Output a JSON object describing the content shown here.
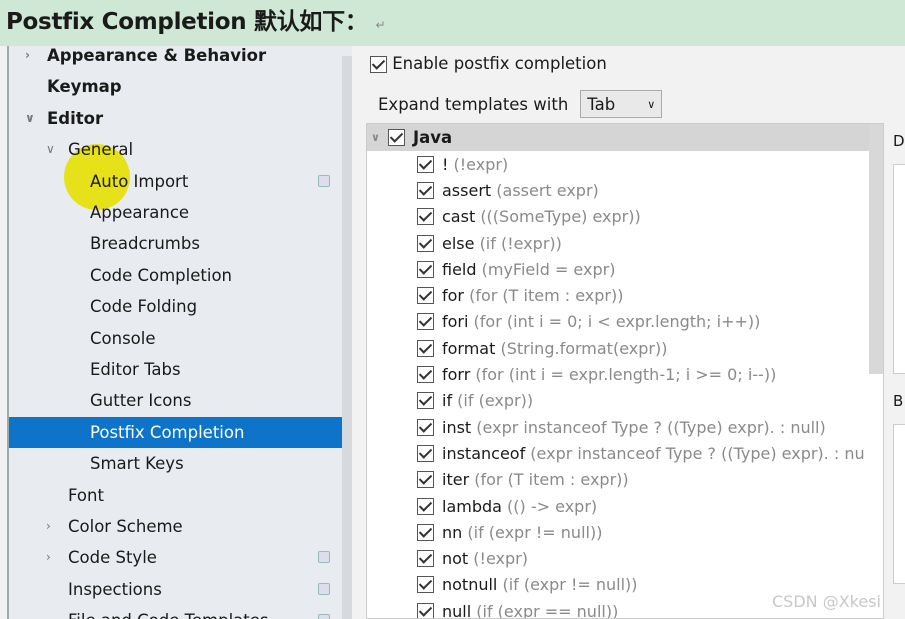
{
  "header": {
    "title": "Postfix Completion 默认如下：",
    "return_mark": "↵"
  },
  "sidebar": {
    "items": [
      {
        "label": "Appearance & Behavior",
        "bold": true,
        "level": 0,
        "arrow": "right"
      },
      {
        "label": "Keymap",
        "bold": true,
        "level": 0
      },
      {
        "label": "Editor",
        "bold": true,
        "level": 0,
        "arrow": "down"
      },
      {
        "label": "General",
        "level": 1,
        "arrow": "down"
      },
      {
        "label": "Auto Import",
        "level": 2,
        "copy": true
      },
      {
        "label": "Appearance",
        "level": 2
      },
      {
        "label": "Breadcrumbs",
        "level": 2
      },
      {
        "label": "Code Completion",
        "level": 2
      },
      {
        "label": "Code Folding",
        "level": 2
      },
      {
        "label": "Console",
        "level": 2
      },
      {
        "label": "Editor Tabs",
        "level": 2
      },
      {
        "label": "Gutter Icons",
        "level": 2
      },
      {
        "label": "Postfix Completion",
        "level": 2,
        "selected": true
      },
      {
        "label": "Smart Keys",
        "level": 2
      },
      {
        "label": "Font",
        "level": 1
      },
      {
        "label": "Color Scheme",
        "level": 1,
        "arrow": "right"
      },
      {
        "label": "Code Style",
        "level": 1,
        "arrow": "right",
        "copy": true
      },
      {
        "label": "Inspections",
        "level": 1,
        "copy": true
      },
      {
        "label": "File and Code Templates",
        "level": 1,
        "copy": true
      }
    ]
  },
  "main": {
    "enable_label": "Enable postfix completion",
    "enable_checked": true,
    "expand_label": "Expand templates with",
    "expand_value": "Tab",
    "group": {
      "label": "Java",
      "checked": true
    },
    "templates": [
      {
        "key": "!",
        "desc": "(!expr)"
      },
      {
        "key": "assert",
        "desc": "(assert expr)"
      },
      {
        "key": "cast",
        "desc": "(((SomeType) expr))"
      },
      {
        "key": "else",
        "desc": "(if (!expr))"
      },
      {
        "key": "field",
        "desc": "(myField = expr)"
      },
      {
        "key": "for",
        "desc": "(for (T item : expr))"
      },
      {
        "key": "fori",
        "desc": "(for (int i = 0; i < expr.length; i++))"
      },
      {
        "key": "format",
        "desc": "(String.format(expr))"
      },
      {
        "key": "forr",
        "desc": "(for (int i = expr.length-1; i >= 0; i--))"
      },
      {
        "key": "if",
        "desc": "(if (expr))"
      },
      {
        "key": "inst",
        "desc": "(expr instanceof Type ? ((Type) expr). : null)"
      },
      {
        "key": "instanceof",
        "desc": "(expr instanceof Type ? ((Type) expr). : nu"
      },
      {
        "key": "iter",
        "desc": "(for (T item : expr))"
      },
      {
        "key": "lambda",
        "desc": "(() -> expr)"
      },
      {
        "key": "nn",
        "desc": "(if (expr != null))"
      },
      {
        "key": "not",
        "desc": "(!expr)"
      },
      {
        "key": "notnull",
        "desc": "(if (expr != null))"
      },
      {
        "key": "null",
        "desc": "(if (expr == null))"
      }
    ],
    "desc_label": "D",
    "before_label": "B"
  },
  "watermark": "CSDN @Xkesi",
  "colors": {
    "selected": "#0d74c9",
    "header_bg": "#cfe8d5",
    "highlight": "#e6e000"
  }
}
